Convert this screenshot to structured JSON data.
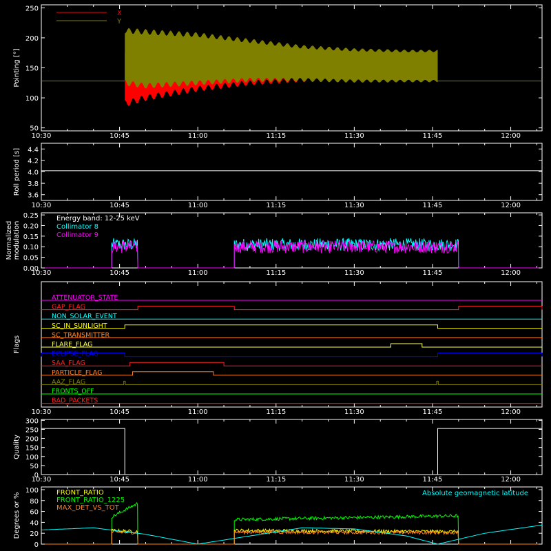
{
  "chart_data": [
    {
      "type": "area",
      "ylabel": "Pointing [°]",
      "xticks": [
        "10:30",
        "10:45",
        "11:00",
        "11:15",
        "11:30",
        "11:45",
        "12:00"
      ],
      "yticks": [
        50,
        100,
        150,
        200,
        250
      ],
      "ylim": [
        45,
        255
      ],
      "xlim": [
        "10:30",
        "12:06"
      ],
      "legend": {
        "placement": "top-left",
        "entries": [
          {
            "name": "X",
            "color": "#ff0000"
          },
          {
            "name": "Y",
            "color": "#808000"
          }
        ]
      },
      "baseline_value": 128,
      "series": [
        {
          "name": "X",
          "color": "#ff0000",
          "x": [
            "10:46",
            "10:50",
            "11:00",
            "11:10",
            "11:20",
            "11:30",
            "11:40",
            "11:46"
          ],
          "lower": [
            90,
            100,
            115,
            125,
            130,
            133,
            134,
            135
          ],
          "upper": [
            180,
            180,
            178,
            176,
            176,
            176,
            176,
            176
          ]
        },
        {
          "name": "Y",
          "color": "#808000",
          "x": [
            "10:46",
            "10:50",
            "11:00",
            "11:10",
            "11:20",
            "11:30",
            "11:40",
            "11:46"
          ],
          "lower": [
            125,
            120,
            125,
            130,
            130,
            128,
            128,
            128
          ],
          "upper": [
            212,
            210,
            205,
            195,
            185,
            180,
            178,
            178
          ]
        }
      ]
    },
    {
      "type": "line",
      "ylabel": "Roll period [s]",
      "xticks": [
        "10:30",
        "10:45",
        "11:00",
        "11:15",
        "11:30",
        "11:45",
        "12:00"
      ],
      "yticks": [
        3.6,
        3.8,
        4.0,
        4.2,
        4.4
      ],
      "ylim": [
        3.5,
        4.5
      ],
      "series": [
        {
          "name": "",
          "color": "#ffffff",
          "x": [
            "10:30",
            "12:06"
          ],
          "y": [
            4.02,
            4.02
          ]
        }
      ]
    },
    {
      "type": "line",
      "ylabel": [
        "Normalized",
        "modulation"
      ],
      "xticks": [
        "10:30",
        "10:45",
        "11:00",
        "11:15",
        "11:30",
        "11:45",
        "12:00"
      ],
      "yticks": [
        0.0,
        0.05,
        0.1,
        0.15,
        0.2,
        0.25
      ],
      "ylim": [
        0,
        0.26
      ],
      "legend": {
        "placement": "top-left",
        "entries": [
          {
            "name": "Energy band: 12-25 keV",
            "color": "#ffffff"
          },
          {
            "name": "Collimator 8",
            "color": "#00ffff"
          },
          {
            "name": "Collimator 9",
            "color": "#ff00ff"
          }
        ]
      },
      "active_intervals": [
        [
          "10:43.5",
          "10:48.5"
        ],
        [
          "11:07",
          "11:50"
        ]
      ],
      "series": [
        {
          "name": "Collimator 8",
          "color": "#00ffff",
          "mean": 0.11,
          "spread": 0.03
        },
        {
          "name": "Collimator 9",
          "color": "#ff00ff",
          "mean": 0.1,
          "spread": 0.03
        }
      ]
    },
    {
      "type": "line",
      "ylabel": "Flags",
      "xticks": [
        "10:30",
        "10:45",
        "11:00",
        "11:15",
        "11:30",
        "11:45",
        "12:00"
      ],
      "flags": [
        {
          "name": "ATTENUATOR_STATE",
          "color": "#ff00ff",
          "steps": []
        },
        {
          "name": "GAP_FLAG",
          "color": "#ff2020",
          "steps": [
            [
              "10:48.5",
              "11:07"
            ],
            [
              "11:50",
              "12:06"
            ]
          ]
        },
        {
          "name": "NON_SOLAR_EVENT",
          "color": "#00ffff",
          "steps": []
        },
        {
          "name": "SC_IN_SUNLIGHT",
          "color": "#ffff00",
          "steps": [
            [
              "10:46",
              "11:46"
            ]
          ]
        },
        {
          "name": "SC_TRANSMITTER",
          "color": "#ff8020",
          "steps": []
        },
        {
          "name": "FLARE_FLAG",
          "color": "#ffff60",
          "steps": [
            [
              "11:37",
              "11:43"
            ]
          ]
        },
        {
          "name": "ECLIPSE_FLAG",
          "color": "#0000ff",
          "steps": [
            [
              "10:30",
              "10:46"
            ],
            [
              "11:46",
              "12:06"
            ]
          ]
        },
        {
          "name": "SAA_FLAG",
          "color": "#ff2020",
          "steps": [
            [
              "10:47",
              "11:05"
            ]
          ]
        },
        {
          "name": "PARTICLE_FLAG",
          "color": "#ff8020",
          "steps": [
            [
              "10:47.5",
              "11:03"
            ]
          ]
        },
        {
          "name": "AAZ_FLAG",
          "color": "#808000",
          "steps": [
            [
              "10:45.8",
              "10:46.1"
            ],
            [
              "11:45.8",
              "11:46.1"
            ]
          ]
        },
        {
          "name": "FRONTS_OFF",
          "color": "#00ff00",
          "steps": []
        },
        {
          "name": "BAD_PACKETS",
          "color": "#ff2020",
          "steps": []
        }
      ]
    },
    {
      "type": "line",
      "ylabel": "Quality",
      "xticks": [
        "10:30",
        "10:45",
        "11:00",
        "11:15",
        "11:30",
        "11:45",
        "12:00"
      ],
      "yticks": [
        0,
        50,
        100,
        150,
        200,
        250,
        300
      ],
      "ylim": [
        0,
        305
      ],
      "series": [
        {
          "name": "",
          "color": "#ffffff",
          "x": [
            "10:30",
            "10:46",
            "10:46",
            "11:46",
            "11:46",
            "12:06"
          ],
          "y": [
            255,
            255,
            0,
            0,
            255,
            255
          ]
        }
      ]
    },
    {
      "type": "line",
      "ylabel": "Degrees or %",
      "yticks": [
        0,
        20,
        40,
        60,
        80,
        100
      ],
      "ylim": [
        0,
        105
      ],
      "legend": {
        "placement": "top-left",
        "entries": [
          {
            "name": "FRONT_RATIO",
            "color": "#ffff00"
          },
          {
            "name": "FRONT_RATIO_1225",
            "color": "#00ff00"
          },
          {
            "name": "MAX_DET_VS_TOT",
            "color": "#ff8020"
          }
        ]
      },
      "annotation": {
        "text": "Absolute geomagnetic latitude",
        "color": "#00ffff"
      },
      "series": [
        {
          "name": "FRONT_RATIO_1225",
          "color": "#00ff00",
          "intervals": [
            [
              "10:43.5",
              "10:48.5"
            ],
            [
              "11:07",
              "11:50"
            ]
          ],
          "start": 45,
          "end": 52
        },
        {
          "name": "FRONT_RATIO",
          "color": "#ffff00",
          "intervals": [
            [
              "10:43.5",
              "10:48.5"
            ],
            [
              "11:07",
              "11:50"
            ]
          ],
          "start": 25,
          "end": 23
        },
        {
          "name": "MAX_DET_VS_TOT",
          "color": "#ff8020",
          "intervals": [
            [
              "10:43.5",
              "10:48.5"
            ],
            [
              "11:07",
              "11:50"
            ]
          ],
          "start": 22,
          "end": 21
        },
        {
          "name": "Absolute geomagnetic latitude",
          "color": "#00ffff",
          "x": [
            "10:30",
            "10:40",
            "10:50",
            "11:00",
            "11:10",
            "11:20",
            "11:30",
            "11:40",
            "11:46",
            "11:55",
            "12:06"
          ],
          "y": [
            26,
            30,
            18,
            0,
            15,
            30,
            28,
            15,
            0,
            20,
            35
          ]
        }
      ]
    }
  ]
}
